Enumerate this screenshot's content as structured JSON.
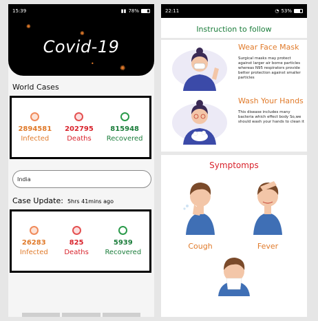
{
  "left": {
    "status": {
      "time": "15:39",
      "battery": "78%"
    },
    "app_title": "Covid-19",
    "world_section_title": "World Cases",
    "world": {
      "infected_value": "2894581",
      "infected_label": "Infected",
      "deaths_value": "202795",
      "deaths_label": "Deaths",
      "recovered_value": "815948",
      "recovered_label": "Recovered"
    },
    "search_value": "India",
    "case_update_label": "Case Update:",
    "case_update_value": "5hrs 41mins ago",
    "country": {
      "infected_value": "26283",
      "infected_label": "Infected",
      "deaths_value": "825",
      "deaths_label": "Deaths",
      "recovered_value": "5939",
      "recovered_label": "Recovered"
    }
  },
  "right": {
    "status": {
      "time": "22:11",
      "battery": "53%"
    },
    "instruction_title": "Instruction to follow",
    "items": [
      {
        "heading": "Wear Face Mask",
        "desc": "Surgical masks may protect against larger air borne particles whereas N95 respirators provide better protection against smaller particles"
      },
      {
        "heading": "Wash Your Hands",
        "desc": "This disease includes many bacteria which effect body So,we should wash your hands to clean it"
      }
    ],
    "symptoms_title": "Symptomps",
    "symptoms": [
      "Cough",
      "Fever"
    ]
  },
  "colors": {
    "infected": "#e07a2a",
    "deaths": "#d8222b",
    "recovered": "#1a7c3a"
  }
}
